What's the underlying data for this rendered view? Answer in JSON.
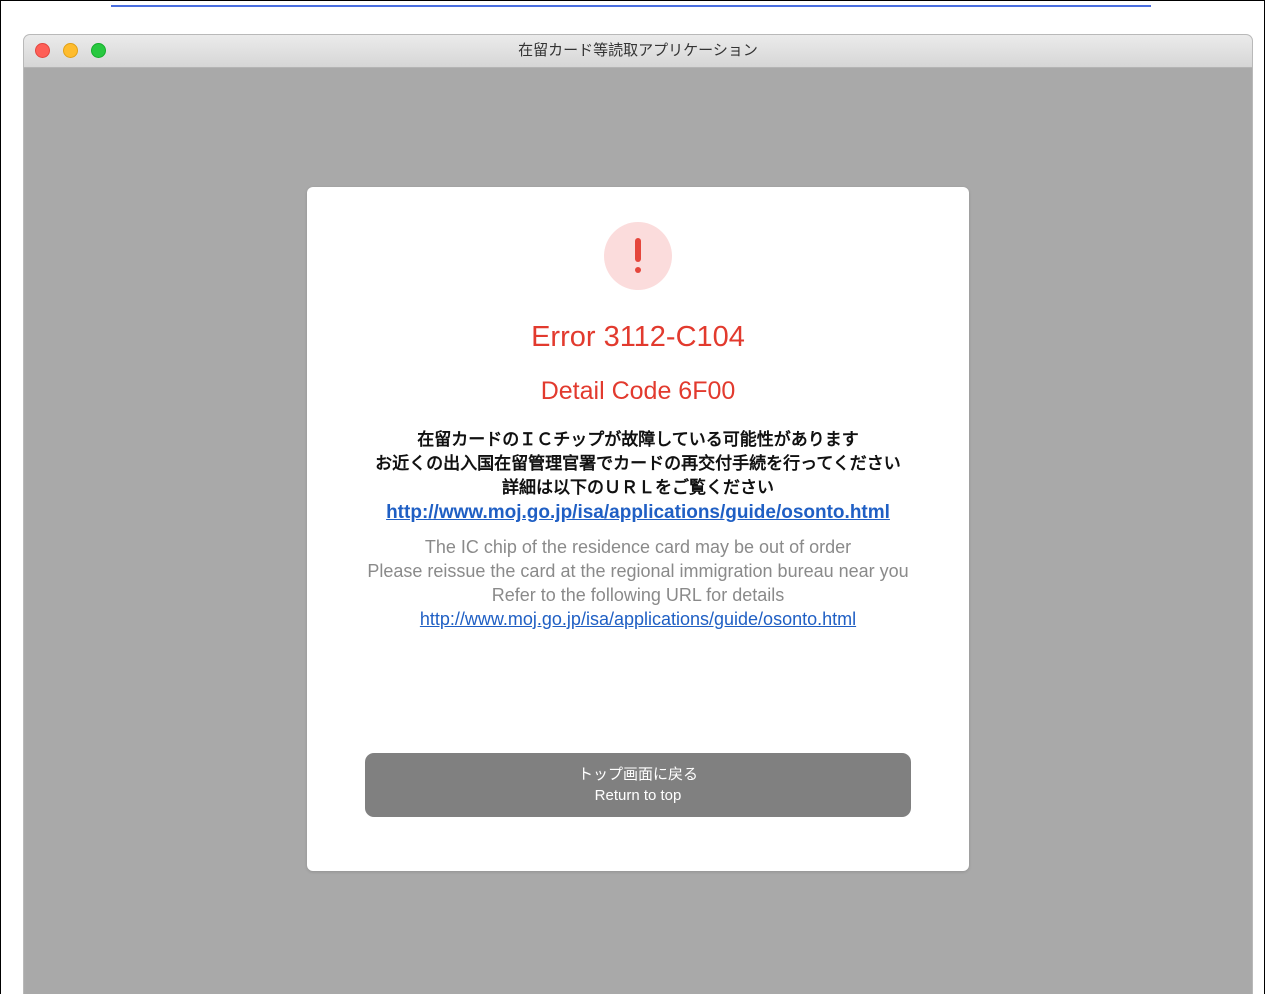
{
  "window": {
    "title": "在留カード等読取アプリケーション"
  },
  "error": {
    "title": "Error 3112-C104",
    "detail_code": "Detail Code 6F00",
    "accent_color": "#e23a2e"
  },
  "message_ja": {
    "lines": [
      "在留カードのＩＣチップが故障している可能性があります",
      "お近くの出入国在留管理官署でカードの再交付手続を行ってください",
      "詳細は以下のＵＲＬをご覧ください"
    ],
    "link": "http://www.moj.go.jp/isa/applications/guide/osonto.html"
  },
  "message_en": {
    "lines": [
      "The IC chip of the residence card may be out of order",
      "Please reissue the card at the regional immigration bureau near you",
      "Refer to the following URL for details"
    ],
    "link": "http://www.moj.go.jp/isa/applications/guide/osonto.html"
  },
  "return_button": {
    "label_ja": "トップ画面に戻る",
    "label_en": "Return to top"
  },
  "icons": {
    "alert": "exclamation-circle-icon"
  }
}
